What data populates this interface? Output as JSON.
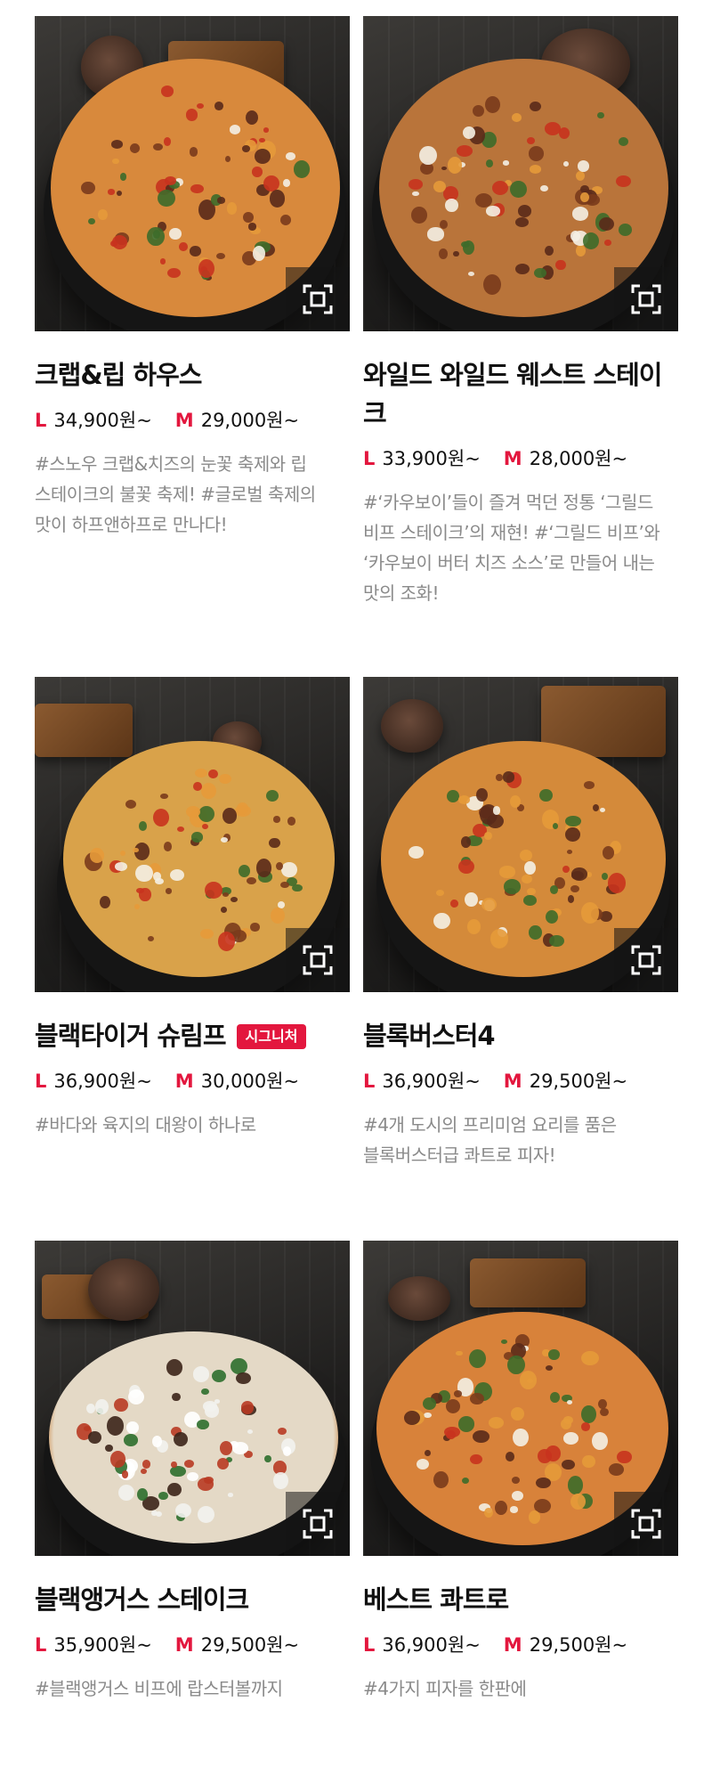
{
  "products": [
    {
      "title": "크랩&립 하우스",
      "badge": "",
      "price_l_size": "L",
      "price_l": "34,900원~",
      "price_m_size": "M",
      "price_m": "29,000원~",
      "desc": "#스노우 크랩&치즈의 눈꽃 축제와 립 스테이크의 불꽃 축제! #글로벌 축제의 맛이 하프앤하프로 만나다!",
      "colors": {
        "sauce": "#d8893c"
      },
      "image_icon": "pizza-image",
      "zoom_icon": "zoom-icon"
    },
    {
      "title": "와일드 와일드 웨스트 스테이크",
      "badge": "",
      "price_l_size": "L",
      "price_l": "33,900원~",
      "price_m_size": "M",
      "price_m": "28,000원~",
      "desc": "#‘카우보이’들이 즐겨 먹던 정통 ‘그릴드 비프 스테이크’의 재현! #‘그릴드 비프’와 ‘카우보이 버터 치즈 소스’로 만들어 내는 맛의 조화!",
      "colors": {
        "sauce": "#b9743a"
      },
      "image_icon": "pizza-image",
      "zoom_icon": "zoom-icon"
    },
    {
      "title": "블랙타이거 슈림프",
      "badge": "시그니처",
      "price_l_size": "L",
      "price_l": "36,900원~",
      "price_m_size": "M",
      "price_m": "30,000원~",
      "desc": "#바다와 육지의 대왕이 하나로",
      "colors": {
        "sauce": "#d9a24a"
      },
      "image_icon": "pizza-image",
      "zoom_icon": "zoom-icon"
    },
    {
      "title": "블록버스터4",
      "badge": "",
      "price_l_size": "L",
      "price_l": "36,900원~",
      "price_m_size": "M",
      "price_m": "29,500원~",
      "desc": "#4개 도시의 프리미엄 요리를 품은 블록버스터급 콰트로 피자!",
      "colors": {
        "sauce": "#d48a3a"
      },
      "image_icon": "pizza-image",
      "zoom_icon": "zoom-icon"
    },
    {
      "title": "블랙앵거스 스테이크",
      "badge": "",
      "price_l_size": "L",
      "price_l": "35,900원~",
      "price_m_size": "M",
      "price_m": "29,500원~",
      "desc": "#블랙앵거스 비프에 랍스터볼까지",
      "colors": {
        "sauce": "#e4d9c6"
      },
      "image_icon": "pizza-image",
      "zoom_icon": "zoom-icon"
    },
    {
      "title": "베스트 콰트로",
      "badge": "",
      "price_l_size": "L",
      "price_l": "36,900원~",
      "price_m_size": "M",
      "price_m": "29,500원~",
      "desc": "#4가지 피자를 한판에",
      "colors": {
        "sauce": "#d8823a"
      },
      "image_icon": "pizza-image",
      "zoom_icon": "zoom-icon"
    }
  ],
  "colors": {
    "accent": "#e3173e",
    "text": "#111111",
    "muted": "#8a8a8a"
  }
}
